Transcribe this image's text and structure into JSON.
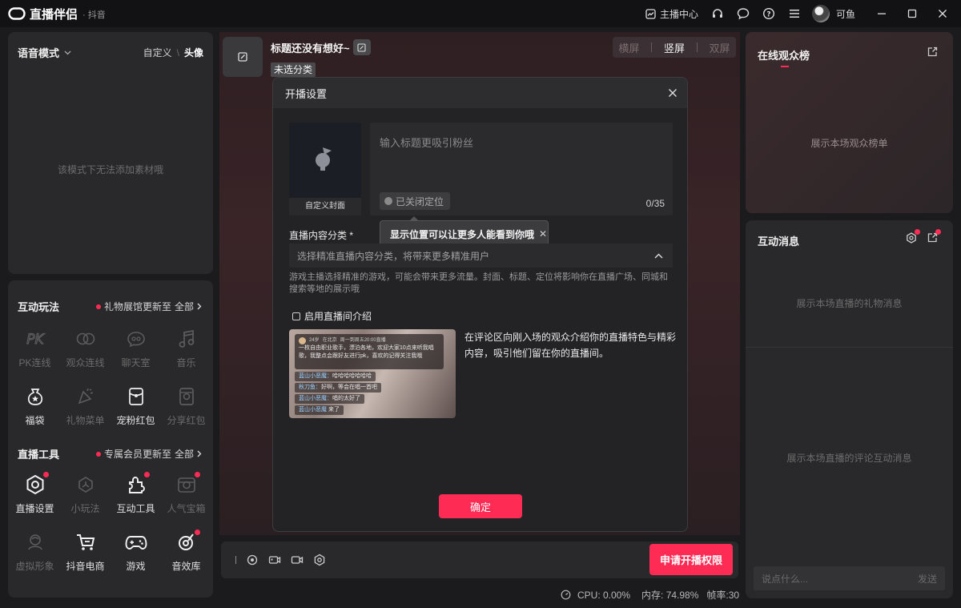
{
  "app": {
    "name": "直播伴侣",
    "platform": "· 抖音",
    "anchor_center": "主播中心",
    "username": "可鱼"
  },
  "voice_panel": {
    "title": "语音模式",
    "link_custom": "自定义",
    "link_sep": "\\",
    "link_avatar": "头像",
    "empty": "该模式下无法添加素材哦"
  },
  "interactive": {
    "title": "互动玩法",
    "notice": "礼物展馆更新至",
    "all": "全部",
    "items": [
      {
        "label": "PK连线",
        "icon": "pk-icon",
        "dim": true
      },
      {
        "label": "观众连线",
        "icon": "audience-link-icon",
        "dim": true
      },
      {
        "label": "聊天室",
        "icon": "chat-room-icon",
        "dim": true
      },
      {
        "label": "音乐",
        "icon": "music-icon",
        "dim": true
      },
      {
        "label": "福袋",
        "icon": "lucky-bag-icon",
        "dim": false
      },
      {
        "label": "礼物菜单",
        "icon": "gift-menu-icon",
        "dim": true
      },
      {
        "label": "宠粉红包",
        "icon": "fan-red-packet-icon",
        "dim": false
      },
      {
        "label": "分享红包",
        "icon": "share-red-packet-icon",
        "dim": true
      }
    ]
  },
  "live_tools": {
    "title": "直播工具",
    "notice": "专属会员更新至",
    "all": "全部",
    "items": [
      {
        "label": "直播设置",
        "icon": "live-settings-icon",
        "dim": false,
        "badge": true
      },
      {
        "label": "小玩法",
        "icon": "mini-games-icon",
        "dim": true,
        "badge": false
      },
      {
        "label": "互动工具",
        "icon": "interactive-tools-icon",
        "dim": false,
        "badge": true
      },
      {
        "label": "人气宝箱",
        "icon": "popularity-box-icon",
        "dim": true,
        "badge": true
      },
      {
        "label": "虚拟形象",
        "icon": "avatar-figure-icon",
        "dim": true,
        "badge": false
      },
      {
        "label": "抖音电商",
        "icon": "shopping-cart-icon",
        "dim": false,
        "badge": false
      },
      {
        "label": "游戏",
        "icon": "gamepad-icon",
        "dim": false,
        "badge": false
      },
      {
        "label": "音效库",
        "icon": "sound-effects-icon",
        "dim": false,
        "badge": true
      }
    ]
  },
  "stage": {
    "title": "标题还没有想好~",
    "category_tag": "未选分类",
    "screen_modes": [
      "横屏",
      "竖屏",
      "双屏"
    ],
    "active_mode": "竖屏"
  },
  "modal": {
    "title": "开播设置",
    "cover_label": "自定义封面",
    "title_placeholder": "输入标题更吸引粉丝",
    "location": "已关闭定位",
    "counter": "0/35",
    "tooltip": "显示位置可以让更多人能看到你哦",
    "category_label": "直播内容分类 *",
    "category_placeholder": "选择精准直播内容分类，将带来更多精准用户",
    "category_desc": "游戏主播选择精准的游戏，可能会带来更多流量。封面、标题、定位将影响你在直播广场、同城和搜索等地的展示哦",
    "intro_checkbox": "启用直播间介绍",
    "intro_desc": "在评论区向刚入场的观众介绍你的直播特色与精彩内容，吸引他们留在你的直播间。",
    "confirm": "确定",
    "preview": {
      "age": "24岁",
      "city": "在北京",
      "schedule": "周一到周五20:00直播",
      "intro": "一枚自由职业歌手，漂泊各地，欢迎大家10点来听我唱歌，我整点会跟好友进行pk，喜欢的记得关注我哦",
      "msgs": [
        {
          "name": "蓝山小恶魔：",
          "text": "哈哈哈哈哈哈哈"
        },
        {
          "name": "秋刀鱼：",
          "text": "好啊，等会在唱一首吧"
        },
        {
          "name": "蓝山小恶魔：",
          "text": "唱的太好了"
        },
        {
          "name": "蓝山小恶魔",
          "text": "来了"
        }
      ]
    }
  },
  "bottom": {
    "apply": "申请开播权限",
    "cpu": "CPU: 0.00%",
    "memory": "内存: 74.98%",
    "fps": "帧率:30"
  },
  "right": {
    "audience_title": "在线观众榜",
    "audience_empty": "展示本场观众榜单",
    "messages_title": "互动消息",
    "gift_empty": "展示本场直播的礼物消息",
    "comment_empty": "展示本场直播的评论互动消息",
    "input_placeholder": "说点什么...",
    "send": "发送"
  }
}
